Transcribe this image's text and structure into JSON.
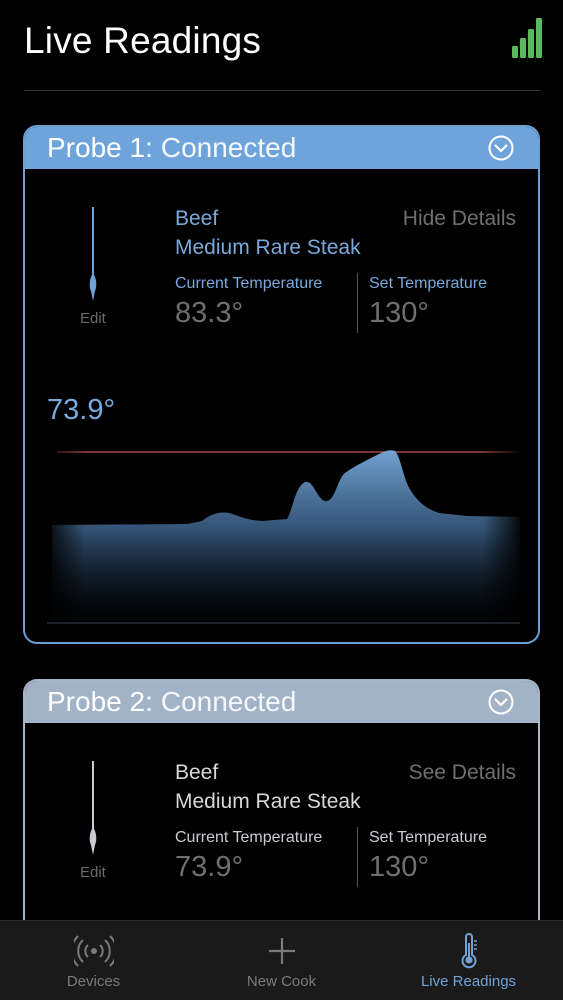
{
  "header": {
    "title": "Live Readings",
    "signal_icon": "signal-bars-icon",
    "accent": "#5cb85c"
  },
  "probes": [
    {
      "name": "Probe 1:",
      "status": "Connected",
      "edit_label": "Edit",
      "food_type": "Beef",
      "food_desc": "Medium Rare Steak",
      "details_link": "Hide Details",
      "current_label": "Current Temperature",
      "current_value": "83.3°",
      "set_label": "Set Temperature",
      "set_value": "130°",
      "graph_value": "73.9°",
      "color": "#6ea4da"
    },
    {
      "name": "Probe 2:",
      "status": "Connected",
      "edit_label": "Edit",
      "food_type": "Beef",
      "food_desc": "Medium Rare Steak",
      "details_link": "See Details",
      "current_label": "Current Temperature",
      "current_value": "73.9°",
      "set_label": "Set Temperature",
      "set_value": "130°",
      "color": "#a3b3c7"
    }
  ],
  "tabs": [
    {
      "label": "Devices",
      "icon": "broadcast-icon",
      "active": false
    },
    {
      "label": "New Cook",
      "icon": "plus-icon",
      "active": false
    },
    {
      "label": "Live Readings",
      "icon": "thermometer-icon",
      "active": true
    }
  ]
}
